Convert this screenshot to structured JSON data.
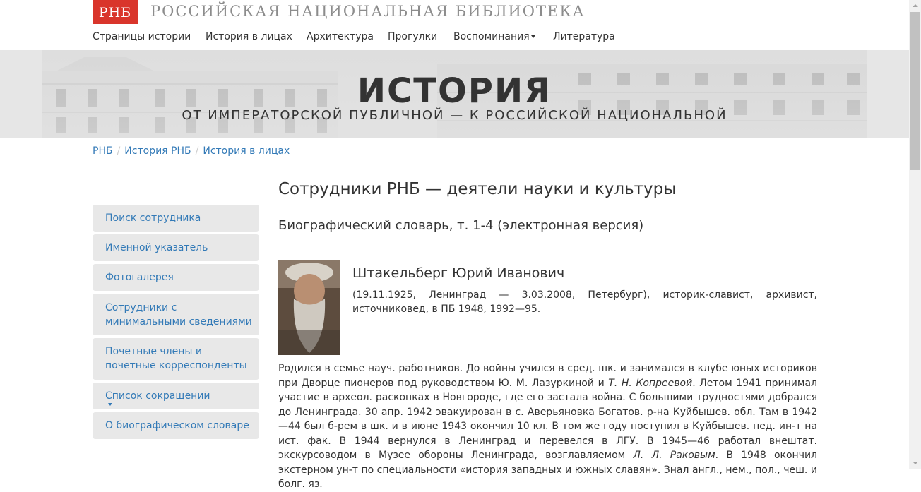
{
  "header": {
    "logo": "РНБ",
    "site_name": "РОССИЙСКАЯ НАЦИОНАЛЬНАЯ БИБЛИОТЕКА"
  },
  "nav": {
    "items": [
      {
        "label": "Страницы истории"
      },
      {
        "label": "История в лицах"
      },
      {
        "label": "Архитектура"
      },
      {
        "label": "Прогулки"
      },
      {
        "label": "Воспоминания"
      },
      {
        "label": "Литература"
      }
    ]
  },
  "banner": {
    "title": "ИСТОРИЯ",
    "subtitle": "ОТ ИМПЕРАТОРСКОЙ ПУБЛИЧНОЙ — К РОССИЙСКОЙ НАЦИОНАЛЬНОЙ"
  },
  "breadcrumb": {
    "items": [
      "РНБ",
      "История РНБ",
      "История в лицах"
    ]
  },
  "sidebar": {
    "items": [
      {
        "label": "Поиск сотрудника"
      },
      {
        "label": "Именной указатель"
      },
      {
        "label": "Фотогалерея"
      },
      {
        "label": "Сотрудники с минимальными сведениями"
      },
      {
        "label": "Почетные члены и почетные корреспонденты"
      },
      {
        "label": "Список сокращений"
      },
      {
        "label": "О биографическом словаре"
      }
    ]
  },
  "main": {
    "title": "Сотрудники РНБ — деятели науки и культуры",
    "subtitle": "Биографический словарь, т. 1-4 (электронная версия)",
    "person": {
      "name": "Штакельберг Юрий Иванович",
      "summary": "(19.11.1925, Ленинград — 3.03.2008, Петербург), историк-славист, архивист, источниковед, в ПБ 1948, 1992—95."
    },
    "bio": {
      "p1": "Родился в семье науч. работников. До войны учился в сред. шк. и занимался в клубе юных историков при Дворце пионеров под руководством Ю. М. Лазуркиной и ",
      "name1": "Т. Н. Копреевой",
      "p2": ". Летом 1941 принимал участие в археол. раскопках в Новгороде, где его застала война. С большими трудностями добрался до Ленинграда. 30 апр. 1942 эвакуирован в с. Аверьяновка Богатов. р-на Куйбышев. обл. Там в 1942—44 был б-рем в шк. и в июне 1943 окончил 10 кл. В том же году поступил в Куйбышев. пед. ин-т на ист. фак. В 1944 вернулся в Ленинград и перевелся в ЛГУ. В 1945—46 работал внештат. экскурсоводом в Музее обороны Ленинграда, возглавляемом ",
      "name2": "Л. Л. Раковым",
      "p3": ". В 1948 окончил экстерном ун-т по специальности «история западных и южных славян». Знал англ., нем., пол., чеш. и болг. яз."
    }
  }
}
